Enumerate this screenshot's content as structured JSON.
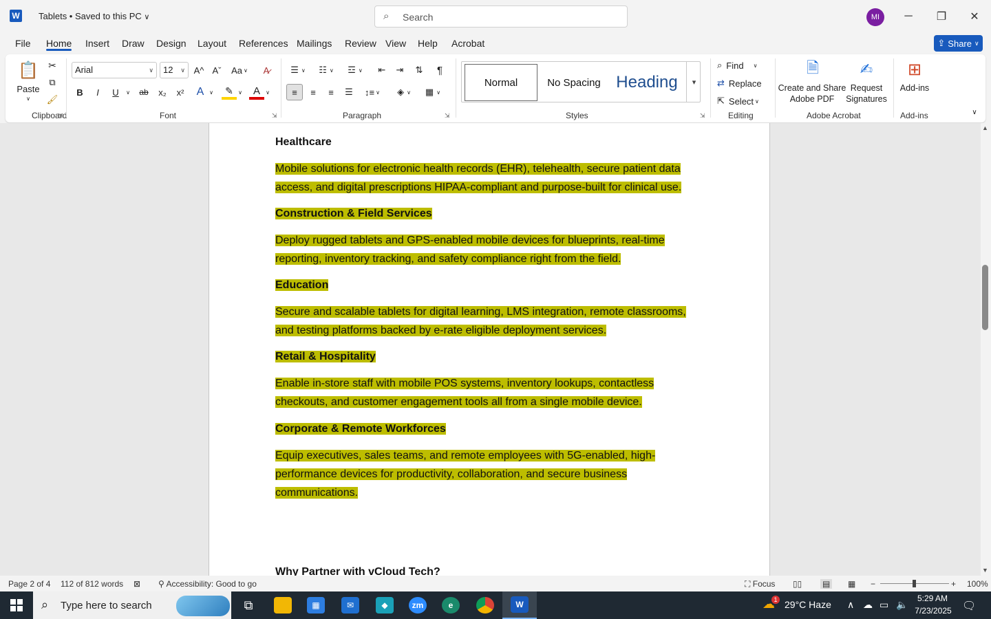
{
  "titlebar": {
    "app_icon": "W",
    "doc_title": "Tablets • Saved to this PC",
    "title_chevron": "⌄",
    "search_placeholder": "Search",
    "avatar_initials": "MI",
    "minimize": "─",
    "restore": "❐",
    "close": "✕"
  },
  "menu": {
    "items": [
      "File",
      "Home",
      "Insert",
      "Draw",
      "Design",
      "Layout",
      "References",
      "Mailings",
      "Review",
      "View",
      "Help",
      "Acrobat"
    ],
    "share_label": "Share"
  },
  "ribbon": {
    "clipboard": {
      "paste_label": "Paste",
      "group_label": "Clipboard"
    },
    "font": {
      "font_name": "Arial",
      "font_size": "12",
      "group_label": "Font",
      "bold": "B",
      "italic": "I",
      "underline": "U",
      "strike": "ab",
      "subscript": "x₂",
      "superscript": "x²",
      "grow": "A^",
      "shrink": "Aˇ",
      "case": "Aa"
    },
    "paragraph": {
      "group_label": "Paragraph",
      "pilcrow": "¶"
    },
    "styles": {
      "group_label": "Styles",
      "items": [
        "Normal",
        "No Spacing",
        "Heading"
      ]
    },
    "editing": {
      "group_label": "Editing",
      "find": "Find",
      "replace": "Replace",
      "select": "Select"
    },
    "acrobat": {
      "group_label": "Adobe Acrobat",
      "create_pdf": "Create and Share Adobe PDF",
      "request_sig": "Request Signatures"
    },
    "addins": {
      "group_label": "Add-ins",
      "label": "Add-ins"
    }
  },
  "document": {
    "heading_healthcare": "Healthcare",
    "healthcare_text": [
      "Mobile solutions for electronic health records (EHR), telehealth, secure patient data",
      "access, and digital prescriptions HIPAA-compliant and purpose-built for clinical use."
    ],
    "heading_construction": "Construction & Field Services",
    "construction_text": [
      "Deploy rugged tablets and GPS-enabled mobile devices for blueprints, real-time",
      "reporting, inventory tracking, and safety compliance right from the field."
    ],
    "heading_education": "Education",
    "education_text": [
      "Secure and scalable tablets for digital learning, LMS integration, remote classrooms,",
      "and testing platforms backed by e-rate eligible deployment services."
    ],
    "heading_retail": "Retail & Hospitality",
    "retail_text": [
      "Enable in-store staff with mobile POS systems, inventory lookups, contactless",
      "checkouts, and customer engagement tools all from a single mobile device."
    ],
    "heading_corporate": "Corporate & Remote Workforces",
    "corporate_text": [
      "Equip executives, sales teams, and remote employees with 5G-enabled, high-",
      "performance devices for productivity, collaboration, and secure business",
      "communications."
    ],
    "heading_partner": "Why Partner with vCloud Tech?"
  },
  "statusbar": {
    "page": "Page 2 of 4",
    "words": "112 of 812 words",
    "accessibility": "Accessibility: Good to go",
    "focus": "Focus",
    "zoom": "100%"
  },
  "taskbar": {
    "search_placeholder": "Type here to search",
    "weather": "29°C  Haze",
    "time": "5:29 AM",
    "date": "7/23/2025",
    "notif_count": "1"
  },
  "colors": {
    "accent": "#185abd",
    "highlight": "#c5c200",
    "selection": "#c8c8c8",
    "avatar": "#7a1ea1"
  }
}
